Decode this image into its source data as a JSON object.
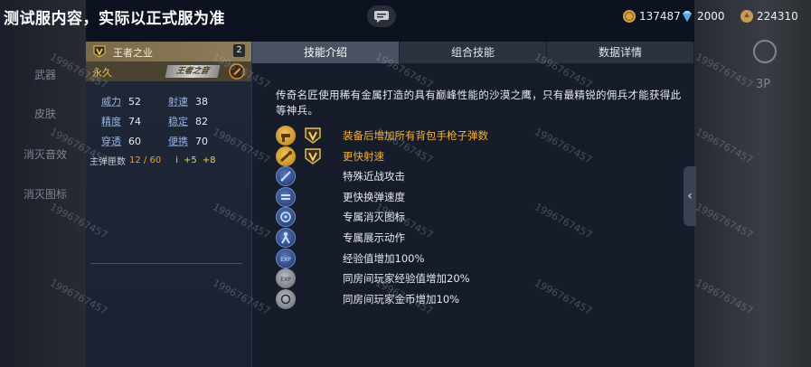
{
  "notice": "测试服内容，实际以正式服为准",
  "currencies": [
    {
      "icon": "gold-coin-icon",
      "value": "137487"
    },
    {
      "icon": "diamond-icon",
      "value": "2000"
    },
    {
      "icon": "honor-coin-icon",
      "value": "224310"
    }
  ],
  "bg_side_labels": [
    "武器",
    "皮肤",
    "消灭音效",
    "消灭图标"
  ],
  "bg_right": {
    "view_label": "3P"
  },
  "watermark": "1996767457",
  "weapon": {
    "name": "王者之业",
    "count": "2",
    "duration": "永久",
    "king_tag": "王者之音",
    "stats": [
      {
        "label": "威力",
        "value": "52"
      },
      {
        "label": "射速",
        "value": "38"
      },
      {
        "label": "精度",
        "value": "74"
      },
      {
        "label": "稳定",
        "value": "82"
      },
      {
        "label": "穿透",
        "value": "60"
      },
      {
        "label": "便携",
        "value": "70"
      }
    ],
    "ammo_label": "主弹匣数",
    "ammo_value": "12 / 60",
    "ammo_bonus_1": "+5",
    "ammo_bonus_2": "+8"
  },
  "tabs": [
    "技能介绍",
    "组合技能",
    "数据详情"
  ],
  "description": "传奇名匠使用稀有金属打造的具有巅峰性能的沙漠之鹰，只有最精锐的佣兵才能获得此等神兵。",
  "skills": [
    {
      "icon": "pistol-ammo-icon",
      "style": "gold",
      "has_badge": true,
      "name": "装备后增加所有背包手枪子弹数",
      "highlight": true
    },
    {
      "icon": "fire-rate-icon",
      "style": "gold",
      "has_badge": true,
      "name": "更快射速",
      "highlight": true
    },
    {
      "icon": "melee-attack-icon",
      "style": "blue",
      "has_badge": false,
      "name": "特殊近战攻击",
      "highlight": false
    },
    {
      "icon": "reload-speed-icon",
      "style": "blue",
      "has_badge": false,
      "name": "更快换弹速度",
      "highlight": false
    },
    {
      "icon": "kill-icon-icon",
      "style": "blue",
      "has_badge": false,
      "name": "专属消灭图标",
      "highlight": false
    },
    {
      "icon": "display-action-icon",
      "style": "blue",
      "has_badge": false,
      "name": "专属展示动作",
      "highlight": false
    },
    {
      "icon": "exp-icon",
      "style": "blue",
      "has_badge": false,
      "name": "经验值增加100%",
      "highlight": false
    },
    {
      "icon": "room-exp-icon",
      "style": "gray",
      "has_badge": false,
      "name": "同房间玩家经验值增加20%",
      "highlight": false
    },
    {
      "icon": "room-coin-icon",
      "style": "gray",
      "has_badge": false,
      "name": "同房间玩家金币增加10%",
      "highlight": false
    }
  ],
  "colors": {
    "highlight": "#f2b23c",
    "stat_label": "#95b4e6",
    "panel_bg": "#161c2a",
    "header_gold": "#8e7d5a"
  }
}
